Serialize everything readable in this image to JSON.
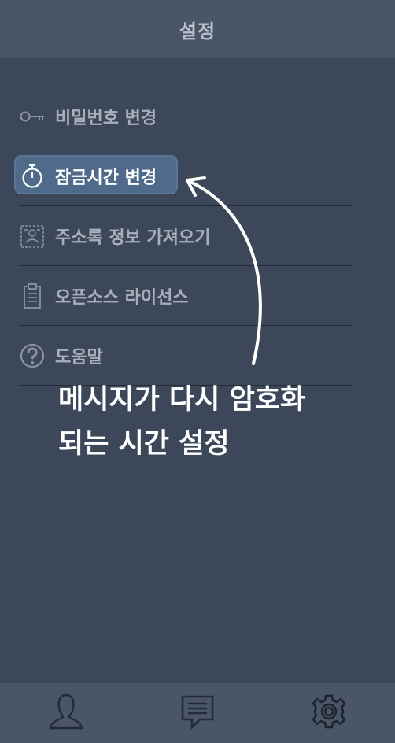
{
  "header": {
    "title": "설정"
  },
  "menu": {
    "items": [
      {
        "label": "비밀번호 변경",
        "icon": "key-icon"
      },
      {
        "label": "잠금시간 변경",
        "icon": "stopwatch-icon",
        "active": true
      },
      {
        "label": "주소록 정보 가져오기",
        "icon": "id-card-icon"
      },
      {
        "label": "오픈소스 라이선스",
        "icon": "clipboard-icon"
      },
      {
        "label": "도움말",
        "icon": "help-icon"
      }
    ]
  },
  "annotation": {
    "line1": "메시지가 다시 암호화",
    "line2": "되는 시간 설정"
  },
  "tabbar": {
    "tabs": [
      {
        "icon": "person-icon"
      },
      {
        "icon": "chat-icon"
      },
      {
        "icon": "gear-icon",
        "active": true
      }
    ]
  },
  "colors": {
    "background": "#3c4859",
    "header": "#4a5667",
    "highlight": "#4f6a8a",
    "text": "#a8afba"
  }
}
